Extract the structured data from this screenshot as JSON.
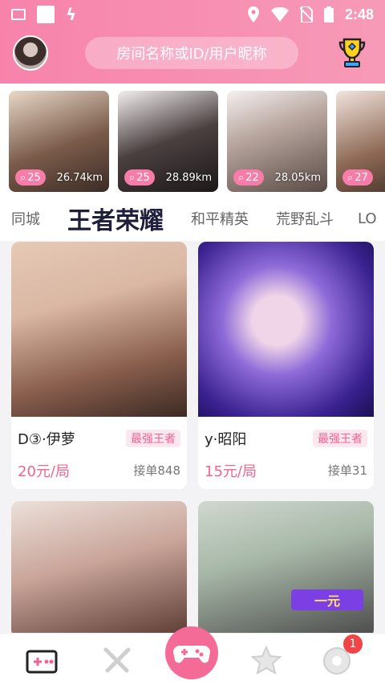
{
  "status_bar": {
    "time": "2:48"
  },
  "header": {
    "search_placeholder": "房间名称或ID/用户昵称"
  },
  "nearby": [
    {
      "count": "25",
      "distance": "26.74km",
      "bg": "#7a5b4a"
    },
    {
      "count": "25",
      "distance": "28.89km",
      "bg": "#4a4040"
    },
    {
      "count": "22",
      "distance": "28.05km",
      "bg": "#8f7f78"
    },
    {
      "count": "27",
      "distance": "",
      "bg": "#8e6a56"
    }
  ],
  "tabs": [
    {
      "label": "同城"
    },
    {
      "label": "王者荣耀"
    },
    {
      "label": "和平精英"
    },
    {
      "label": "荒野乱斗"
    },
    {
      "label": "LO"
    }
  ],
  "cards": [
    {
      "name": "D③·伊萝",
      "tag": "最强王者",
      "price": "20元/局",
      "orders": "接单848",
      "bg": "#d9b7a3"
    },
    {
      "name": "y·昭阳",
      "tag": "最强王者",
      "price": "15元/局",
      "orders": "接单31",
      "bg": "#5b3fb8"
    },
    {
      "name": "",
      "tag": "",
      "price": "",
      "orders": "",
      "bg": "#c9a59a"
    },
    {
      "name": "",
      "tag": "",
      "price": "",
      "orders": "",
      "bg": "#a8b8a8",
      "promo": "一元"
    }
  ],
  "nav": {
    "badge_count": "1"
  },
  "colors": {
    "brand": "#f56b98",
    "topbar": "#f783ab"
  }
}
